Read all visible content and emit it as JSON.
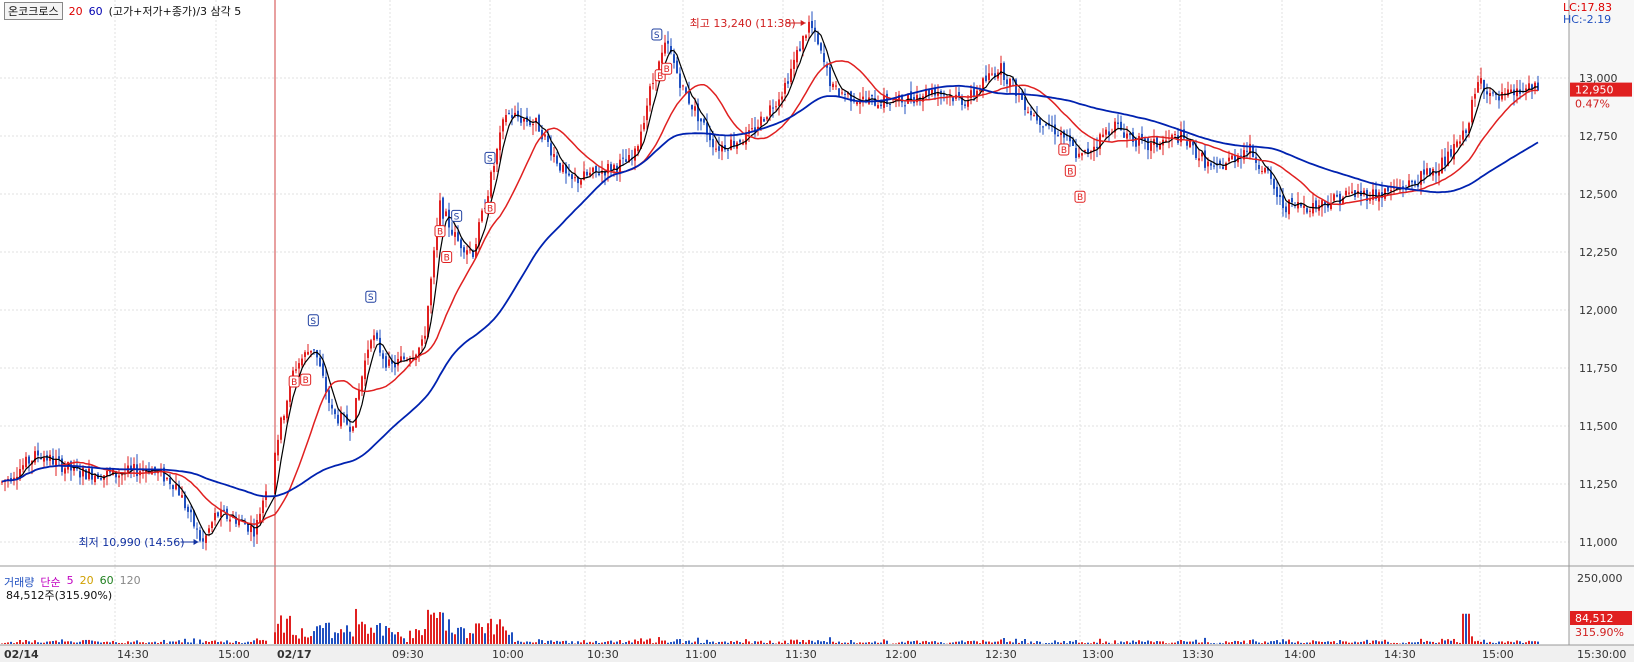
{
  "header": {
    "indicator_label": "온코크로스",
    "period_1": "20",
    "period_2": "60",
    "formula": "(고가+저가+종가)/3 삼각 5"
  },
  "right_info": {
    "lc": "LC:17.83",
    "hc": "HC:-2.19"
  },
  "volume_panel": {
    "legend_title": "거래량",
    "ma_label": "단순",
    "ma_periods": [
      "5",
      "20",
      "60",
      "120"
    ],
    "current_volume": "84,512주(315.90%)"
  },
  "annotations": {
    "high": "최고 13,240 (11:38)",
    "low": "최저 10,990 (14:56)"
  },
  "price_tags": {
    "price": "12,950",
    "change": "0.47%",
    "volume": "84,512",
    "volume_pct": "315.90%"
  },
  "colors": {
    "up": "#e02020",
    "down": "#2050c0",
    "ma5": "#000000",
    "ma20": "#e02020",
    "ma60": "#0022b0",
    "grid": "#e2e2e2",
    "tag_bg": "#e02020"
  },
  "chart_data": {
    "type": "candlestick",
    "title": "",
    "price_axis": {
      "ylim": [
        10900,
        13300
      ],
      "ticks": [
        "13,000",
        "12,750",
        "12,500",
        "12,250",
        "12,000",
        "11,750",
        "11,500",
        "11,250",
        "11,000"
      ]
    },
    "volume_axis": {
      "ticks": [
        "250,000"
      ]
    },
    "x_ticks": [
      "02/14",
      "14:30",
      "15:00",
      "02/17",
      "09:30",
      "10:00",
      "10:30",
      "11:00",
      "11:30",
      "12:00",
      "12:30",
      "13:00",
      "13:30",
      "14:00",
      "14:30",
      "15:00",
      "15:30:00"
    ],
    "day_divider_label": "02/17",
    "grid": true,
    "series_close_profile": [
      [
        "02/14 14:00",
        11250
      ],
      [
        "02/14 14:10",
        11380
      ],
      [
        "02/14 14:20",
        11300
      ],
      [
        "02/14 14:30",
        11290
      ],
      [
        "02/14 14:40",
        11320
      ],
      [
        "02/14 14:48",
        11250
      ],
      [
        "02/14 14:56",
        10990
      ],
      [
        "02/14 15:00",
        11120
      ],
      [
        "02/14 15:10",
        11100
      ],
      [
        "02/14 15:20",
        11050
      ],
      [
        "02/17 09:00",
        11400
      ],
      [
        "02/17 09:05",
        11750
      ],
      [
        "02/17 09:10",
        11850
      ],
      [
        "02/17 09:15",
        11550
      ],
      [
        "02/17 09:20",
        11500
      ],
      [
        "02/17 09:25",
        11900
      ],
      [
        "02/17 09:30",
        11750
      ],
      [
        "02/17 09:40",
        11850
      ],
      [
        "02/17 09:45",
        12450
      ],
      [
        "02/17 09:50",
        12300
      ],
      [
        "02/17 09:55",
        12250
      ],
      [
        "02/17 10:00",
        12550
      ],
      [
        "02/17 10:05",
        12850
      ],
      [
        "02/17 10:15",
        12800
      ],
      [
        "02/17 10:25",
        12550
      ],
      [
        "02/17 10:35",
        12600
      ],
      [
        "02/17 10:45",
        12650
      ],
      [
        "02/17 10:50",
        12950
      ],
      [
        "02/17 10:55",
        13150
      ],
      [
        "02/17 11:00",
        12950
      ],
      [
        "02/17 11:10",
        12700
      ],
      [
        "02/17 11:20",
        12750
      ],
      [
        "02/17 11:30",
        12950
      ],
      [
        "02/17 11:38",
        13240
      ],
      [
        "02/17 11:45",
        12950
      ],
      [
        "02/17 11:55",
        12900
      ],
      [
        "02/17 12:05",
        12900
      ],
      [
        "02/17 12:15",
        12950
      ],
      [
        "02/17 12:25",
        12900
      ],
      [
        "02/17 12:35",
        13050
      ],
      [
        "02/17 12:45",
        12850
      ],
      [
        "02/17 12:55",
        12750
      ],
      [
        "02/17 13:00",
        12650
      ],
      [
        "02/17 13:10",
        12800
      ],
      [
        "02/17 13:20",
        12700
      ],
      [
        "02/17 13:30",
        12750
      ],
      [
        "02/17 13:40",
        12600
      ],
      [
        "02/17 13:50",
        12700
      ],
      [
        "02/17 13:55",
        12600
      ],
      [
        "02/17 14:00",
        12450
      ],
      [
        "02/17 14:10",
        12450
      ],
      [
        "02/17 14:20",
        12500
      ],
      [
        "02/17 14:30",
        12500
      ],
      [
        "02/17 14:40",
        12550
      ],
      [
        "02/17 14:50",
        12650
      ],
      [
        "02/17 14:55",
        12750
      ],
      [
        "02/17 15:00",
        13000
      ],
      [
        "02/17 15:05",
        12900
      ],
      [
        "02/17 15:15",
        12950
      ],
      [
        "02/17 15:20",
        12950
      ]
    ],
    "signals": [
      {
        "type": "B",
        "at": "02/17 09:05"
      },
      {
        "type": "B",
        "at": "02/17 09:08"
      },
      {
        "type": "S",
        "at": "02/17 09:10"
      },
      {
        "type": "S",
        "at": "02/17 09:25"
      },
      {
        "type": "B",
        "at": "02/17 09:45"
      },
      {
        "type": "B",
        "at": "02/17 09:47"
      },
      {
        "type": "S",
        "at": "02/17 09:50"
      },
      {
        "type": "B",
        "at": "02/17 10:00"
      },
      {
        "type": "S",
        "at": "02/17 10:00"
      },
      {
        "type": "B",
        "at": "02/17 10:53"
      },
      {
        "type": "B",
        "at": "02/17 10:55"
      },
      {
        "type": "S",
        "at": "02/17 10:52"
      },
      {
        "type": "B",
        "at": "02/17 12:55"
      },
      {
        "type": "B",
        "at": "02/17 12:57"
      },
      {
        "type": "B",
        "at": "02/17 13:00"
      }
    ]
  }
}
